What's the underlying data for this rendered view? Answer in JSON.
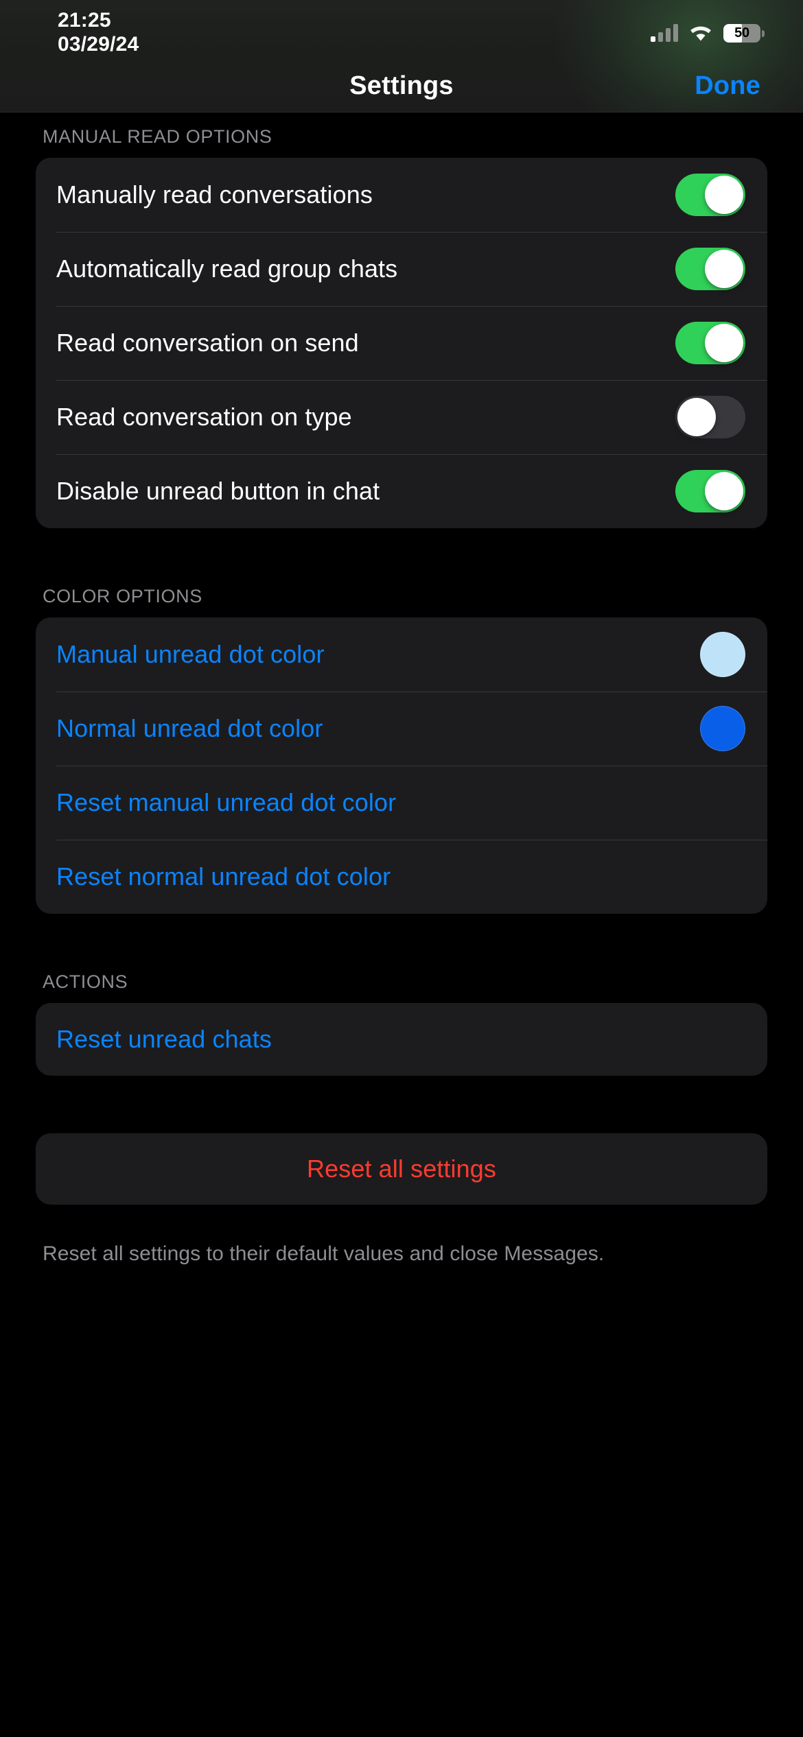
{
  "status_bar": {
    "time": "21:25",
    "date": "03/29/24",
    "signal_icon": "cellular-bars-icon",
    "wifi_icon": "wifi-icon",
    "battery_percent": "50",
    "battery_level": 50
  },
  "nav": {
    "title": "Settings",
    "done_label": "Done",
    "accent_color": "#0A84FF"
  },
  "sections": [
    {
      "header": "MANUAL READ OPTIONS",
      "rows": [
        {
          "label": "Manually read conversations",
          "toggle": "on"
        },
        {
          "label": "Automatically read group chats",
          "toggle": "on"
        },
        {
          "label": "Read conversation on send",
          "toggle": "on"
        },
        {
          "label": "Read conversation on type",
          "toggle": "off"
        },
        {
          "label": "Disable unread button in chat",
          "toggle": "on"
        }
      ]
    },
    {
      "header": "COLOR OPTIONS",
      "rows": [
        {
          "label": "Manual unread dot color",
          "color": "#BEE3F8"
        },
        {
          "label": "Normal unread dot color",
          "color": "#0A5FE8"
        },
        {
          "label": "Reset manual unread dot color"
        },
        {
          "label": "Reset normal unread dot color"
        }
      ]
    },
    {
      "header": "ACTIONS",
      "rows": [
        {
          "label": "Reset unread chats"
        }
      ]
    }
  ],
  "destructive": {
    "label": "Reset all settings",
    "color": "#FF3B30",
    "footer": "Reset all settings to their default values and close Messages."
  },
  "colors": {
    "toggle_on": "#30D158",
    "toggle_off": "#39393D",
    "card_bg": "#1C1C1E",
    "page_bg": "#000000",
    "section_header": "#8E8E93"
  }
}
